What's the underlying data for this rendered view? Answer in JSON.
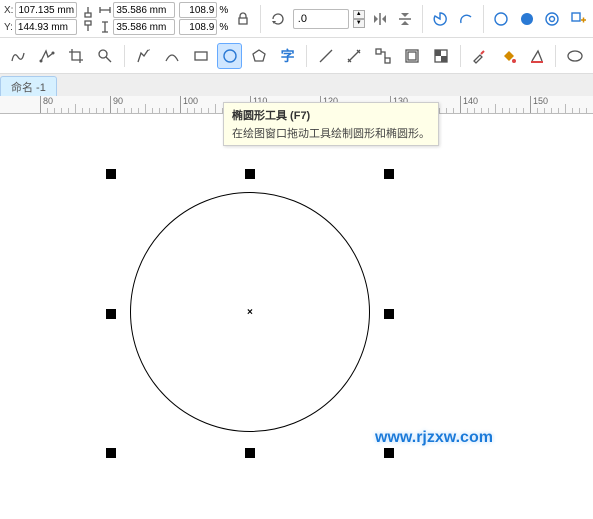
{
  "propbar": {
    "x_label": "X:",
    "y_label": "Y:",
    "x_value": "107.135 mm",
    "y_value": "144.93 mm",
    "w_value": "35.586 mm",
    "h_value": "35.586 mm",
    "scale_x": "108.9",
    "scale_y": "108.9",
    "pct": "%",
    "angle": ".0"
  },
  "tabs": {
    "doc1": "命名 -1"
  },
  "ruler": {
    "marks": [
      "80",
      "90",
      "100",
      "110",
      "120",
      "130",
      "140",
      "150"
    ]
  },
  "tooltip": {
    "title": "椭圆形工具 (F7)",
    "desc": "在绘图窗口拖动工具绘制圆形和椭圆形。"
  },
  "watermark": "www.rjzxw.com"
}
